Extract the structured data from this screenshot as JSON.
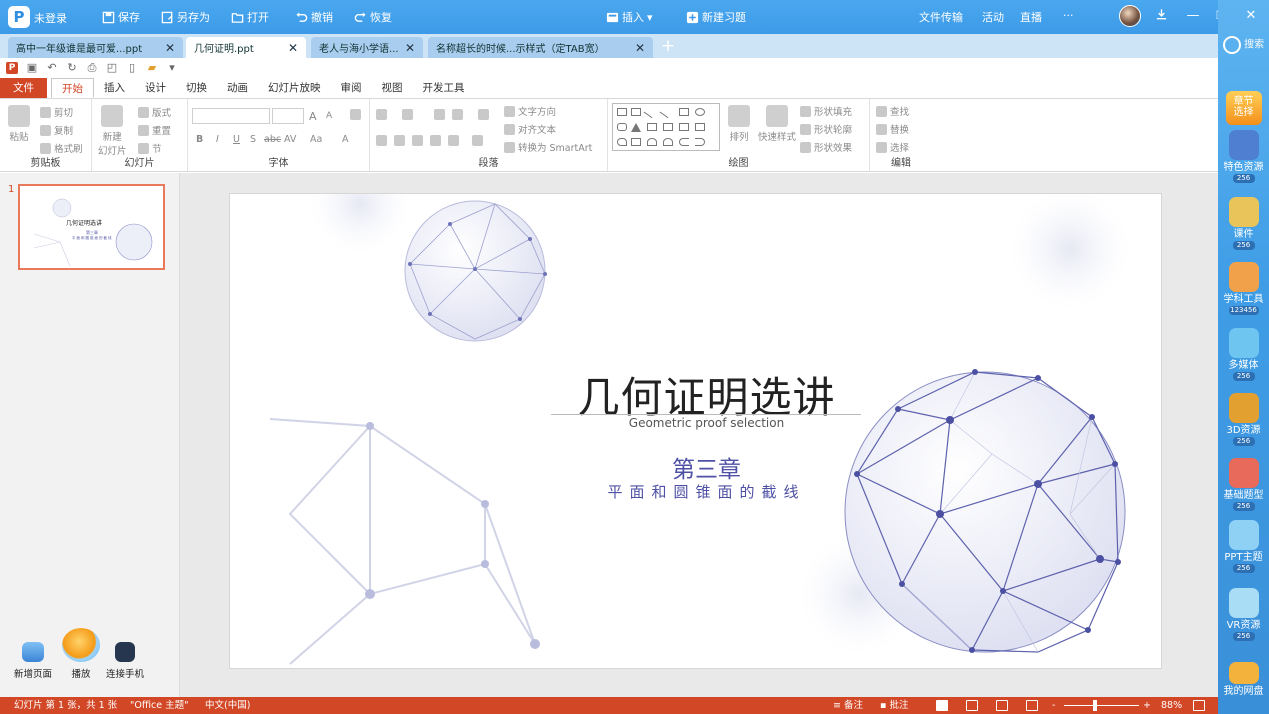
{
  "titlebar": {
    "logo": "P",
    "guest": "未登录",
    "buttons": [
      "保存",
      "另存为",
      "打开",
      "撤销",
      "恢复"
    ],
    "insert": "插入",
    "new_quiz": "新建习题",
    "right_links": [
      "文件传输",
      "活动",
      "直播"
    ],
    "more": "···",
    "download_icon": "download-icon",
    "minimize": "—",
    "maximize": "❐",
    "close": "✕"
  },
  "tabs": [
    {
      "label": "高中一年级谁是最可爱...ppt",
      "active": false
    },
    {
      "label": "几何证明.ppt",
      "active": true
    },
    {
      "label": "老人与海小学语...",
      "active": false
    },
    {
      "label": "名称超长的时候...示样式（定TAB宽）",
      "active": false
    }
  ],
  "tab_add": "+",
  "menus": [
    "文件",
    "开始",
    "插入",
    "设计",
    "切换",
    "动画",
    "幻灯片放映",
    "审阅",
    "视图",
    "开发工具"
  ],
  "ribbon": {
    "clipboard": {
      "label": "剪贴板",
      "paste": "粘贴",
      "cut": "剪切",
      "copy": "复制",
      "format_painter": "格式刷"
    },
    "slides": {
      "label": "幻灯片",
      "new_slide": "新建\n幻灯片",
      "layout": "版式",
      "reset": "重置",
      "section": "节"
    },
    "font": {
      "label": "字体",
      "bold": "B",
      "italic": "I",
      "underline": "U",
      "shadow": "S",
      "strike": "abc",
      "spacing": "AV",
      "case": "Aa",
      "color": "A",
      "grow": "A",
      "shrink": "A"
    },
    "paragraph": {
      "label": "段落",
      "text_direction": "文字方向",
      "align_text": "对齐文本",
      "smartart": "转换为 SmartArt"
    },
    "drawing": {
      "label": "绘图",
      "arrange": "排列",
      "quick_styles": "快速样式",
      "shape_fill": "形状填充",
      "shape_outline": "形状轮廓",
      "shape_effects": "形状效果"
    },
    "editing": {
      "label": "编辑",
      "find": "查找",
      "replace": "替换",
      "select": "选择"
    }
  },
  "thumbnail": {
    "number": "1",
    "title": "几何证明选讲",
    "chapter": "第三章",
    "subtitle": "平面和圆锥面的截线"
  },
  "slide": {
    "title": "几何证明选讲",
    "subtitle_en": "Geometric proof selection",
    "chapter": "第三章",
    "topic": "平面和圆锥面的截线"
  },
  "bottom_tools": [
    "新增页面",
    "播放",
    "连接手机"
  ],
  "right_panel": {
    "search": "搜索",
    "top_badge": "章节\n选择",
    "items": [
      {
        "label": "特色资源",
        "badge": "256",
        "color": "#4f7fd0"
      },
      {
        "label": "课件",
        "badge": "256",
        "color": "#e8c45a"
      },
      {
        "label": "学科工具",
        "badge": "123456",
        "color": "#f0a14a"
      },
      {
        "label": "多媒体",
        "badge": "256",
        "color": "#6ec6f0"
      },
      {
        "label": "3D资源",
        "badge": "256",
        "color": "#e2a030"
      },
      {
        "label": "基础题型",
        "badge": "256",
        "color": "#e86a5a"
      },
      {
        "label": "PPT主题",
        "badge": "256",
        "color": "#8fd0f5"
      },
      {
        "label": "VR资源",
        "badge": "256",
        "color": "#a9dcf5"
      }
    ],
    "netdisk": "我的网盘"
  },
  "statusbar": {
    "slide_info": "幻灯片 第 1 张，共 1 张",
    "theme": "\"Office 主题\"",
    "language": "中文(中国)",
    "notes": "备注",
    "comments": "批注",
    "zoom_minus": "-",
    "zoom_plus": "+",
    "zoom": "88%"
  },
  "colors": {
    "accent": "#d24726",
    "titlebar": "#3d9ae8",
    "slide_blue": "#4e51a5"
  }
}
